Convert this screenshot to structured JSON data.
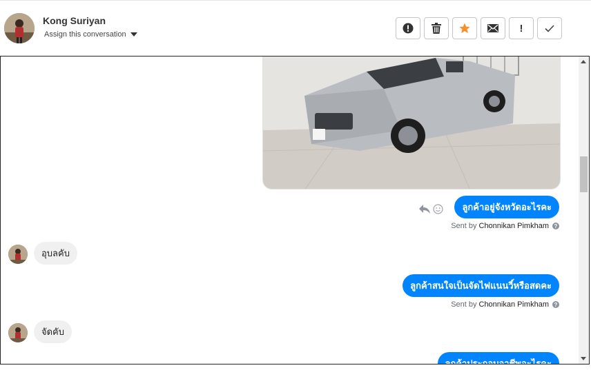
{
  "header": {
    "contact_name": "Kong Suriyan",
    "assign_label": "Assign this conversation",
    "toolbar": [
      {
        "icon": "alert-circle-icon",
        "name": "mark-spam-button"
      },
      {
        "icon": "trash-icon",
        "name": "delete-button"
      },
      {
        "icon": "star-icon",
        "name": "star-button"
      },
      {
        "icon": "envelope-icon",
        "name": "mark-unread-button"
      },
      {
        "icon": "exclamation-icon",
        "name": "follow-up-button"
      },
      {
        "icon": "check-icon",
        "name": "mark-done-button"
      }
    ],
    "exclamation_glyph": "!",
    "star_color": "#f5902c"
  },
  "conversation": {
    "messages": [
      {
        "direction": "outgoing",
        "type": "image",
        "alt": "silver pickup truck"
      },
      {
        "direction": "outgoing",
        "text": "ลูกค้าอยู่จังหวัดอะไรคะ",
        "sent_by_prefix": "Sent by",
        "sender": "Chonnikan Pimkham"
      },
      {
        "direction": "incoming",
        "text": "อุบลคับ"
      },
      {
        "direction": "outgoing",
        "text": "ลูกค้าสนใจเป็นจัดไฟแนนวิ์หรือสดคะ",
        "sent_by_prefix": "Sent by",
        "sender": "Chonnikan Pimkham"
      },
      {
        "direction": "incoming",
        "text": "จัดคับ"
      },
      {
        "direction": "outgoing",
        "text": "ลูกค้าประกอบอาชีพอะไรคะ"
      }
    ],
    "info_glyph": "?",
    "accent_color": "#0084ff"
  }
}
